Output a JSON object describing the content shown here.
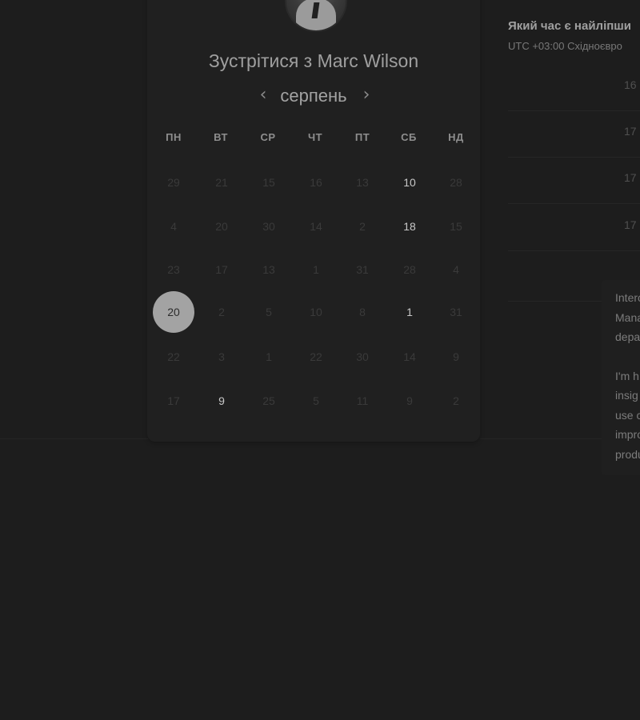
{
  "calendar": {
    "title": "Зустрітися з Marc Wilson",
    "month": "серпень",
    "prev_icon": "chevron-left-icon",
    "next_icon": "chevron-right-icon",
    "weekdays": [
      "ПН",
      "ВТ",
      "СР",
      "ЧТ",
      "ПТ",
      "СБ",
      "НД"
    ],
    "weeks": [
      [
        {
          "d": "29",
          "s": "muted"
        },
        {
          "d": "21",
          "s": "muted"
        },
        {
          "d": "15",
          "s": "muted"
        },
        {
          "d": "16",
          "s": "muted"
        },
        {
          "d": "13",
          "s": "muted"
        },
        {
          "d": "10",
          "s": "available"
        },
        {
          "d": "28",
          "s": "muted"
        }
      ],
      [
        {
          "d": "4",
          "s": "muted"
        },
        {
          "d": "20",
          "s": "muted"
        },
        {
          "d": "30",
          "s": "muted"
        },
        {
          "d": "14",
          "s": "muted"
        },
        {
          "d": "2",
          "s": "muted"
        },
        {
          "d": "18",
          "s": "available"
        },
        {
          "d": "15",
          "s": "muted"
        }
      ],
      [
        {
          "d": "23",
          "s": "muted"
        },
        {
          "d": "17",
          "s": "muted"
        },
        {
          "d": "13",
          "s": "muted"
        },
        {
          "d": "1",
          "s": "muted"
        },
        {
          "d": "31",
          "s": "muted"
        },
        {
          "d": "28",
          "s": "muted"
        },
        {
          "d": "4",
          "s": "muted"
        }
      ],
      [
        {
          "d": "20",
          "s": "selected"
        },
        {
          "d": "2",
          "s": "muted"
        },
        {
          "d": "5",
          "s": "muted"
        },
        {
          "d": "10",
          "s": "muted"
        },
        {
          "d": "8",
          "s": "muted"
        },
        {
          "d": "1",
          "s": "available"
        },
        {
          "d": "31",
          "s": "muted"
        }
      ],
      [
        {
          "d": "22",
          "s": "muted"
        },
        {
          "d": "3",
          "s": "muted"
        },
        {
          "d": "1",
          "s": "muted"
        },
        {
          "d": "22",
          "s": "muted"
        },
        {
          "d": "30",
          "s": "muted"
        },
        {
          "d": "14",
          "s": "muted"
        },
        {
          "d": "9",
          "s": "muted"
        }
      ],
      [
        {
          "d": "17",
          "s": "muted"
        },
        {
          "d": "9",
          "s": "available"
        },
        {
          "d": "25",
          "s": "muted"
        },
        {
          "d": "5",
          "s": "muted"
        },
        {
          "d": "11",
          "s": "muted"
        },
        {
          "d": "9",
          "s": "muted"
        },
        {
          "d": "2",
          "s": "muted"
        }
      ]
    ]
  },
  "schedule": {
    "question": "Який час є найліпши",
    "timezone": "UTC +03:00 Східноєвро",
    "slots": [
      "16",
      "17",
      "17",
      "17"
    ]
  },
  "bio": {
    "paragraph1": [
      "Interc",
      "Mana",
      "depa"
    ],
    "paragraph2": [
      "I'm h",
      "insig",
      "use c",
      "impro",
      "produ"
    ]
  },
  "colors": {
    "background": "#1d1d1d",
    "card": "#202020",
    "selected_day": "#a3a3a3"
  }
}
